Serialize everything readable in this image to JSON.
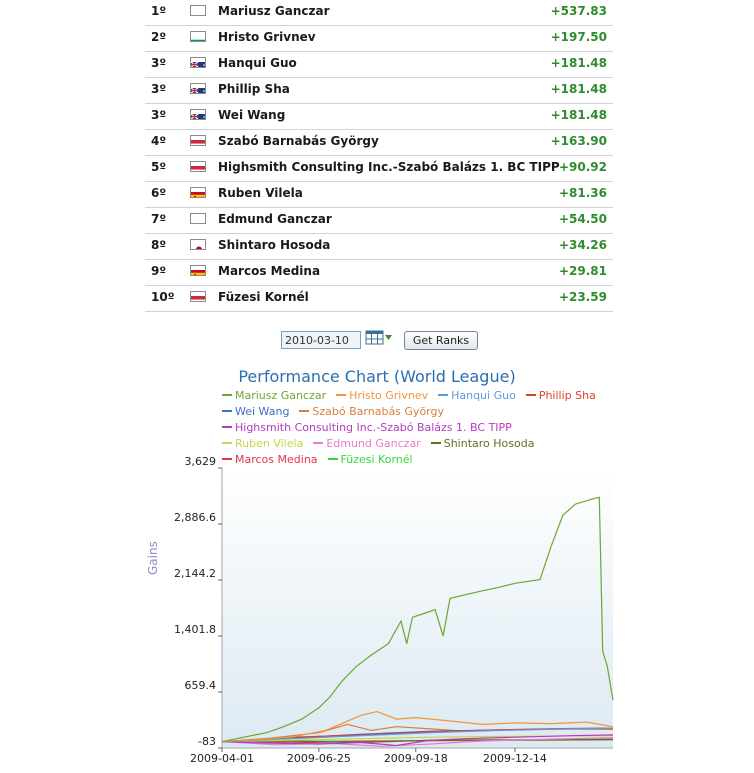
{
  "rankings": [
    {
      "rank": "1º",
      "country": "poland",
      "name": "Mariusz Ganczar",
      "gain": "+537.83"
    },
    {
      "rank": "2º",
      "country": "bulgaria",
      "name": "Hristo Grivnev",
      "gain": "+197.50"
    },
    {
      "rank": "3º",
      "country": "australia",
      "name": "Hanqui Guo",
      "gain": "+181.48"
    },
    {
      "rank": "3º",
      "country": "australia",
      "name": "Phillip Sha",
      "gain": "+181.48"
    },
    {
      "rank": "3º",
      "country": "australia",
      "name": "Wei Wang",
      "gain": "+181.48"
    },
    {
      "rank": "4º",
      "country": "hungary",
      "name": "Szabó Barnabás György",
      "gain": "+163.90"
    },
    {
      "rank": "5º",
      "country": "hungary",
      "name": "Highsmith Consulting Inc.-Szabó Balázs 1. BC TIPP",
      "gain": "+90.92"
    },
    {
      "rank": "6º",
      "country": "spain",
      "name": "Ruben Vilela",
      "gain": "+81.36"
    },
    {
      "rank": "7º",
      "country": "poland",
      "name": "Edmund Ganczar",
      "gain": "+54.50"
    },
    {
      "rank": "8º",
      "country": "japan",
      "name": "Shintaro Hosoda",
      "gain": "+34.26"
    },
    {
      "rank": "9º",
      "country": "spain",
      "name": "Marcos Medina",
      "gain": "+29.81"
    },
    {
      "rank": "10º",
      "country": "hungary",
      "name": "Füzesi Kornél",
      "gain": "+23.59"
    }
  ],
  "controls": {
    "date_value": "2010-03-10",
    "calendar_icon": "calendar-dropdown-icon",
    "button_label": "Get Ranks"
  },
  "chart_data": {
    "type": "line",
    "title": "Performance Chart (World League)",
    "ylabel": "Gains",
    "xlabel": "",
    "ylim": [
      -83,
      3629
    ],
    "yticks": [
      "3,629",
      "2,886.6",
      "2,144.2",
      "1,401.8",
      "659.4",
      "-83"
    ],
    "xticks": [
      "2009-04-01",
      "2009-06-25",
      "2009-09-18",
      "2009-12-14"
    ],
    "x_start": "2009-04-01",
    "x_end": "2010-03-10",
    "legend_position": "top",
    "series": [
      {
        "name": "Mariusz Ganczar",
        "color": "#6aa832",
        "points": [
          [
            "2009-04-01",
            0
          ],
          [
            "2009-04-20",
            60
          ],
          [
            "2009-05-10",
            120
          ],
          [
            "2009-05-25",
            200
          ],
          [
            "2009-06-10",
            300
          ],
          [
            "2009-06-25",
            450
          ],
          [
            "2009-07-05",
            600
          ],
          [
            "2009-07-15",
            800
          ],
          [
            "2009-07-28",
            1000
          ],
          [
            "2009-08-10",
            1150
          ],
          [
            "2009-08-25",
            1300
          ],
          [
            "2009-09-05",
            1600
          ],
          [
            "2009-09-10",
            1300
          ],
          [
            "2009-09-15",
            1650
          ],
          [
            "2009-09-25",
            1700
          ],
          [
            "2009-10-05",
            1750
          ],
          [
            "2009-10-12",
            1400
          ],
          [
            "2009-10-18",
            1900
          ],
          [
            "2009-11-01",
            1950
          ],
          [
            "2009-11-15",
            2000
          ],
          [
            "2009-12-01",
            2050
          ],
          [
            "2009-12-14",
            2100
          ],
          [
            "2010-01-05",
            2150
          ],
          [
            "2010-01-15",
            2600
          ],
          [
            "2010-01-20",
            2800
          ],
          [
            "2010-01-25",
            3000
          ],
          [
            "2010-02-05",
            3150
          ],
          [
            "2010-02-20",
            3220
          ],
          [
            "2010-02-26",
            3240
          ],
          [
            "2010-03-01",
            1200
          ],
          [
            "2010-03-05",
            1000
          ],
          [
            "2010-03-10",
            550
          ]
        ]
      },
      {
        "name": "Hristo Grivnev",
        "color": "#f0953a",
        "points": [
          [
            "2009-04-01",
            0
          ],
          [
            "2009-05-01",
            30
          ],
          [
            "2009-06-01",
            60
          ],
          [
            "2009-07-01",
            150
          ],
          [
            "2009-08-01",
            350
          ],
          [
            "2009-08-15",
            400
          ],
          [
            "2009-09-01",
            300
          ],
          [
            "2009-09-18",
            320
          ],
          [
            "2009-10-15",
            280
          ],
          [
            "2009-11-15",
            230
          ],
          [
            "2009-12-14",
            250
          ],
          [
            "2010-01-15",
            240
          ],
          [
            "2010-02-15",
            260
          ],
          [
            "2010-03-10",
            200
          ]
        ]
      },
      {
        "name": "Hanqui Guo",
        "color": "#5a9be0",
        "points": [
          [
            "2009-04-01",
            0
          ],
          [
            "2009-06-01",
            40
          ],
          [
            "2009-08-01",
            80
          ],
          [
            "2009-10-01",
            120
          ],
          [
            "2009-12-01",
            150
          ],
          [
            "2010-02-01",
            170
          ],
          [
            "2010-03-10",
            180
          ]
        ]
      },
      {
        "name": "Phillip Sha",
        "color": "#d9442e",
        "points": [
          [
            "2009-04-01",
            0
          ],
          [
            "2009-06-01",
            60
          ],
          [
            "2009-08-01",
            90
          ],
          [
            "2009-10-01",
            130
          ],
          [
            "2009-12-01",
            160
          ],
          [
            "2010-02-01",
            175
          ],
          [
            "2010-03-10",
            181
          ]
        ]
      },
      {
        "name": "Wei Wang",
        "color": "#3e6fc4",
        "points": [
          [
            "2009-04-01",
            0
          ],
          [
            "2009-06-01",
            50
          ],
          [
            "2009-08-01",
            100
          ],
          [
            "2009-10-01",
            140
          ],
          [
            "2009-12-01",
            155
          ],
          [
            "2010-02-01",
            172
          ],
          [
            "2010-03-10",
            181
          ]
        ]
      },
      {
        "name": "Szabó Barnabás György",
        "color": "#d97f3e",
        "points": [
          [
            "2009-04-01",
            0
          ],
          [
            "2009-05-15",
            50
          ],
          [
            "2009-06-25",
            120
          ],
          [
            "2009-07-20",
            230
          ],
          [
            "2009-08-10",
            150
          ],
          [
            "2009-09-01",
            200
          ],
          [
            "2009-10-01",
            170
          ],
          [
            "2009-11-01",
            140
          ],
          [
            "2009-12-14",
            160
          ],
          [
            "2010-01-15",
            170
          ],
          [
            "2010-03-10",
            164
          ]
        ]
      },
      {
        "name": "Highsmith Consulting Inc.-Szabó Balázs 1. BC TIPP",
        "color": "#b23cc2",
        "points": [
          [
            "2009-04-01",
            0
          ],
          [
            "2009-05-15",
            -20
          ],
          [
            "2009-06-25",
            -30
          ],
          [
            "2009-08-01",
            -10
          ],
          [
            "2009-09-01",
            -50
          ],
          [
            "2009-10-01",
            20
          ],
          [
            "2009-11-01",
            40
          ],
          [
            "2009-12-14",
            60
          ],
          [
            "2010-02-01",
            80
          ],
          [
            "2010-03-10",
            91
          ]
        ]
      },
      {
        "name": "Ruben Vilela",
        "color": "#c8d44a",
        "points": [
          [
            "2009-04-01",
            0
          ],
          [
            "2009-06-01",
            20
          ],
          [
            "2009-08-01",
            40
          ],
          [
            "2009-10-01",
            60
          ],
          [
            "2009-12-01",
            70
          ],
          [
            "2010-03-10",
            81
          ]
        ]
      },
      {
        "name": "Edmund Ganczar",
        "color": "#e87ad0",
        "points": [
          [
            "2009-04-01",
            0
          ],
          [
            "2009-05-20",
            -40
          ],
          [
            "2009-07-01",
            -20
          ],
          [
            "2009-08-20",
            -60
          ],
          [
            "2009-10-01",
            -30
          ],
          [
            "2009-11-15",
            10
          ],
          [
            "2010-01-01",
            30
          ],
          [
            "2010-03-10",
            54
          ]
        ]
      },
      {
        "name": "Shintaro Hosoda",
        "color": "#6b6b2a",
        "points": [
          [
            "2009-04-01",
            0
          ],
          [
            "2009-06-01",
            10
          ],
          [
            "2009-08-01",
            -10
          ],
          [
            "2009-10-01",
            20
          ],
          [
            "2009-12-01",
            25
          ],
          [
            "2010-03-10",
            34
          ]
        ]
      },
      {
        "name": "Marcos Medina",
        "color": "#e3344a",
        "points": [
          [
            "2009-04-01",
            0
          ],
          [
            "2009-06-01",
            -15
          ],
          [
            "2009-08-01",
            5
          ],
          [
            "2009-10-01",
            15
          ],
          [
            "2009-12-01",
            20
          ],
          [
            "2010-03-10",
            30
          ]
        ]
      },
      {
        "name": "Füzesi Kornél",
        "color": "#39d43a",
        "points": [
          [
            "2009-04-01",
            0
          ],
          [
            "2009-06-01",
            5
          ],
          [
            "2009-08-01",
            10
          ],
          [
            "2009-10-01",
            15
          ],
          [
            "2009-12-01",
            18
          ],
          [
            "2010-03-10",
            24
          ]
        ]
      }
    ]
  }
}
